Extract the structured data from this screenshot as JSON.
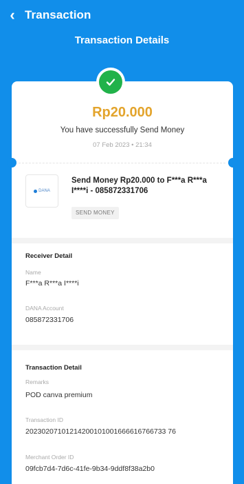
{
  "header": {
    "back_glyph": "‹",
    "title": "Transaction",
    "subtitle": "Transaction Details"
  },
  "status": {
    "icon": "check-circle-icon",
    "amount": "Rp20.000",
    "message": "You have successfully Send Money",
    "datetime": "07 Feb 2023 • 21:34"
  },
  "transaction": {
    "merchant_logo": "dana-logo",
    "merchant_logo_text": "DANA",
    "title": "Send Money Rp20.000 to F***a R***a I****i - 085872331706",
    "badge": "SEND MONEY"
  },
  "receiver_detail": {
    "title": "Receiver Detail",
    "name_label": "Name",
    "name_value": "F***a R***a I****i",
    "account_label": "DANA Account",
    "account_value": "085872331706"
  },
  "transaction_detail": {
    "title": "Transaction Detail",
    "remarks_label": "Remarks",
    "remarks_value": "POD canva premium",
    "tx_id_label": "Transaction ID",
    "tx_id_value": "20230207101214200101001666616766733 76",
    "order_id_label": "Merchant Order ID",
    "order_id_value": "09fcb7d4-7d6c-41fe-9b34-9ddf8f38a2b0"
  },
  "colors": {
    "primary": "#118EEA",
    "amount": "#E3A42C",
    "success": "#21B24A"
  }
}
